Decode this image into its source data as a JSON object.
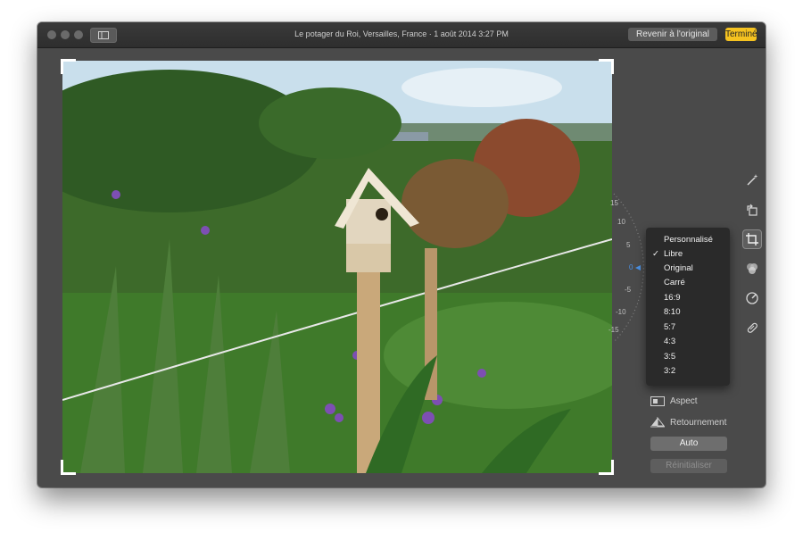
{
  "window": {
    "title": "Le potager du Roi, Versailles, France  ·  1 août 2014 3:27 PM",
    "revert_label": "Revenir à l'original",
    "done_label": "Terminé"
  },
  "dial": {
    "labels": [
      "15",
      "10",
      "5",
      "0",
      "-5",
      "-10",
      "-15"
    ],
    "value": 0
  },
  "tools": [
    {
      "name": "magic-wand-icon",
      "active": false
    },
    {
      "name": "rotate-icon",
      "active": false
    },
    {
      "name": "crop-icon",
      "active": true
    },
    {
      "name": "filters-icon",
      "active": false
    },
    {
      "name": "adjust-icon",
      "active": false
    },
    {
      "name": "retouch-icon",
      "active": false
    }
  ],
  "aspect_menu": {
    "items": [
      "Personnalisé",
      "Libre",
      "Original",
      "Carré",
      "16:9",
      "8:10",
      "5:7",
      "4:3",
      "3:5",
      "3:2"
    ],
    "checked": "Libre"
  },
  "options": {
    "aspect_label": "Aspect",
    "flip_label": "Retournement"
  },
  "buttons": {
    "auto_label": "Auto",
    "reset_label": "Réinitialiser"
  },
  "colors": {
    "accent_done": "#f5c220",
    "window_bg": "#4a4a4a",
    "menu_bg": "#2a2a2a"
  }
}
